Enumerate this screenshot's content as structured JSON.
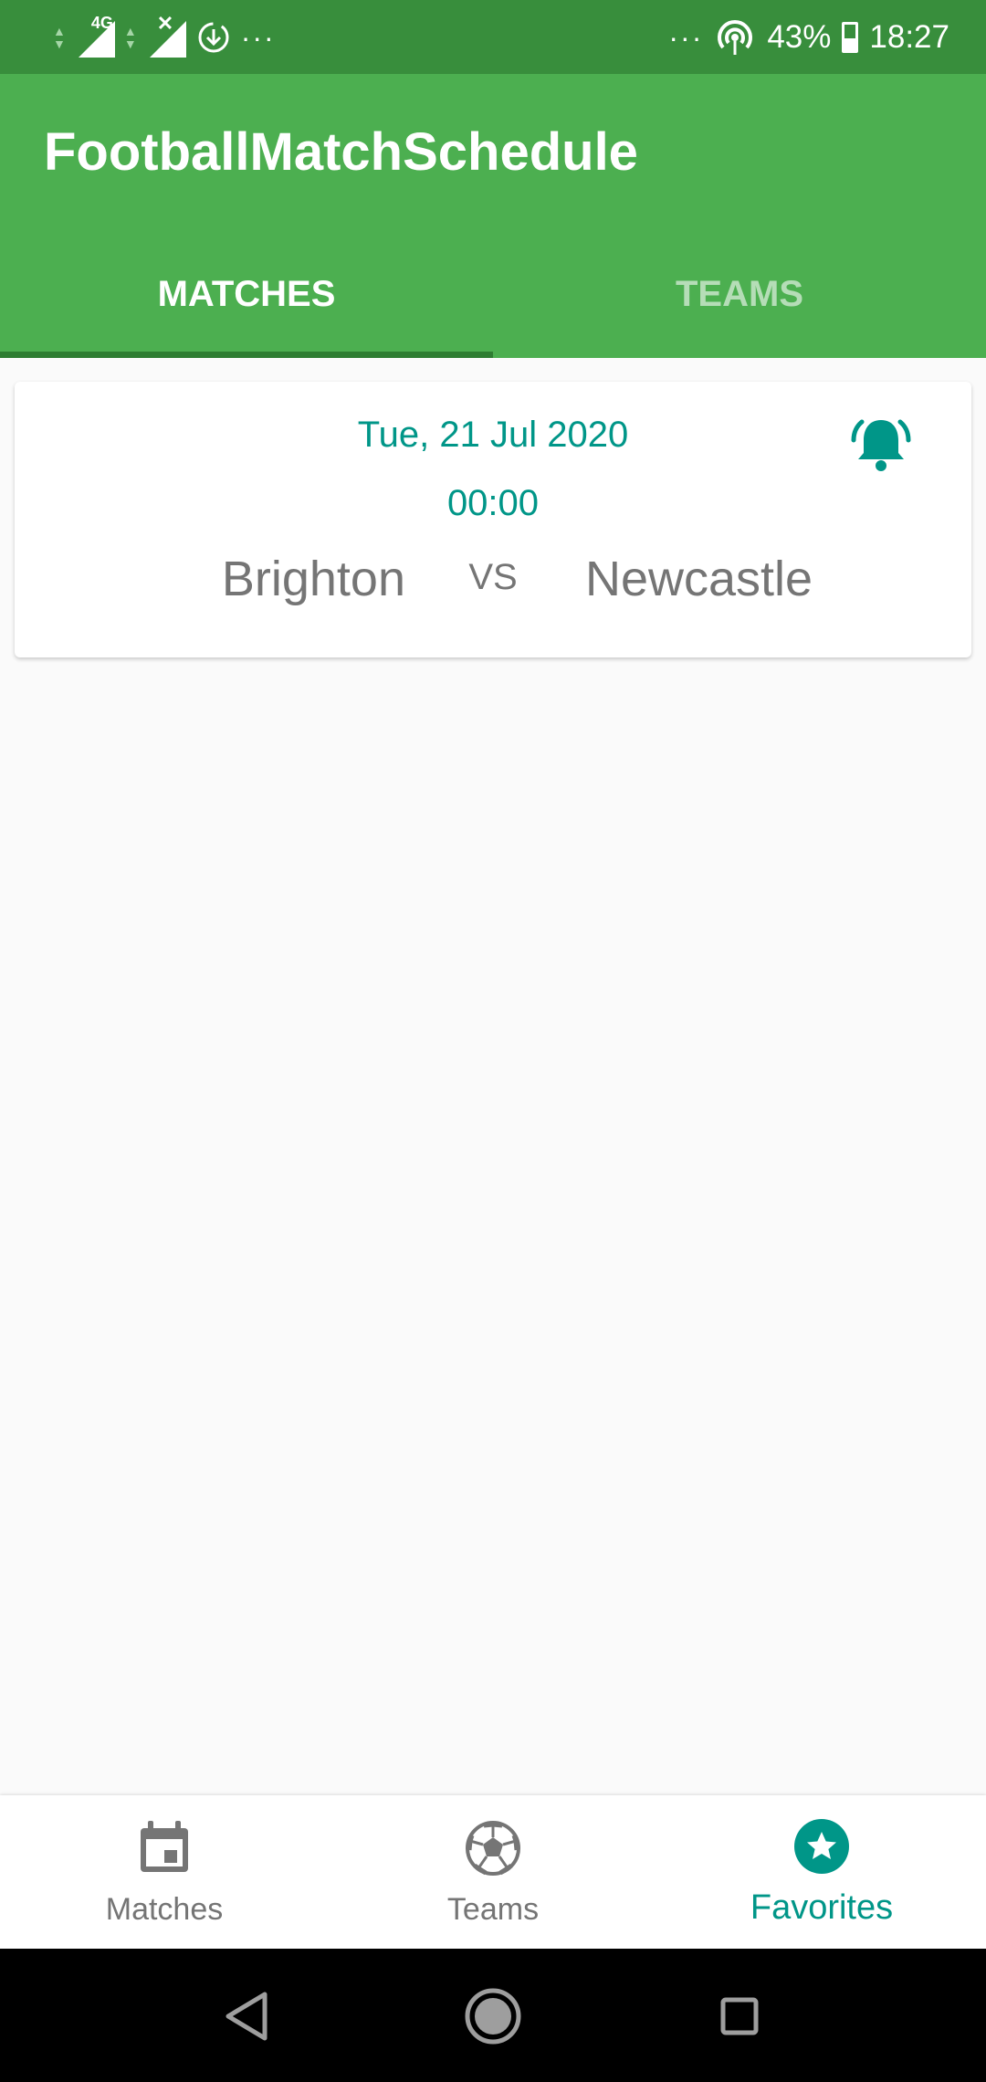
{
  "status_bar": {
    "network_label": "4G",
    "overflow_left": "···",
    "overflow_right": "···",
    "battery_percent": "43%",
    "time": "18:27"
  },
  "app_bar": {
    "title": "FootballMatchSchedule",
    "tabs": [
      {
        "label": "MATCHES",
        "active": true
      },
      {
        "label": "TEAMS",
        "active": false
      }
    ]
  },
  "match": {
    "date": "Tue, 21 Jul 2020",
    "time": "00:00",
    "home_team": "Brighton",
    "vs_label": "VS",
    "away_team": "Newcastle",
    "reminder_icon": "alarm-bell-icon"
  },
  "bottom_nav": {
    "items": [
      {
        "label": "Matches",
        "icon": "calendar-icon",
        "selected": false
      },
      {
        "label": "Teams",
        "icon": "soccer-ball-icon",
        "selected": false
      },
      {
        "label": "Favorites",
        "icon": "star-circle-icon",
        "selected": true
      }
    ]
  },
  "colors": {
    "status_bar": "#388e3c",
    "app_bar": "#4caf50",
    "tab_indicator": "#2e7d32",
    "accent": "#009688",
    "text_grey": "#757575"
  }
}
